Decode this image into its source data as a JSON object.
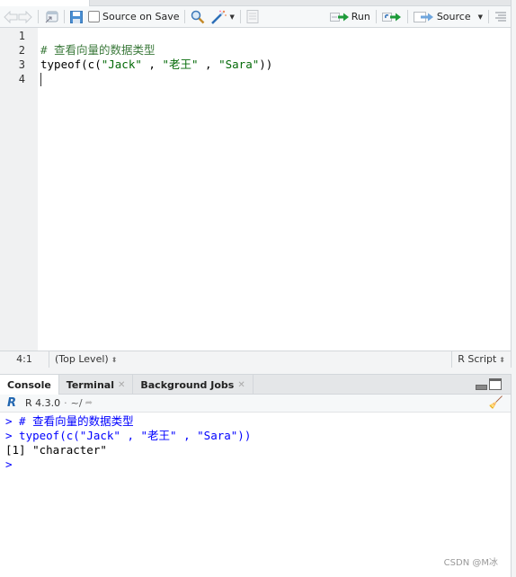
{
  "editor": {
    "toolbar": {
      "source_on_save_label": "Source on Save",
      "source_on_save_checked": false,
      "run_label": "Run",
      "source_label": "Source"
    },
    "line_numbers": [
      "1",
      "2",
      "3",
      "4"
    ],
    "lines": [
      {
        "parts": []
      },
      {
        "parts": [
          {
            "cls": "comment",
            "text": "# 查看向量的数据类型"
          }
        ]
      },
      {
        "parts": [
          {
            "cls": "",
            "text": "typeof(c("
          },
          {
            "cls": "str",
            "text": "\"Jack\""
          },
          {
            "cls": "",
            "text": " , "
          },
          {
            "cls": "str",
            "text": "\"老王\""
          },
          {
            "cls": "",
            "text": " , "
          },
          {
            "cls": "str",
            "text": "\"Sara\""
          },
          {
            "cls": "",
            "text": "))"
          }
        ]
      },
      {
        "parts": [],
        "cursor": true
      }
    ],
    "status": {
      "position": "4:1",
      "scope": "(Top Level)",
      "file_type": "R Script"
    }
  },
  "console": {
    "tabs": [
      {
        "label": "Console",
        "active": true,
        "closable": false
      },
      {
        "label": "Terminal",
        "active": false,
        "closable": true
      },
      {
        "label": "Background Jobs",
        "active": false,
        "closable": true
      }
    ],
    "r_version": "R 4.3.0",
    "separator": "·",
    "working_dir": "~/",
    "lines": [
      {
        "prompt": ">",
        "text": " # 查看向量的数据类型",
        "kind": "input"
      },
      {
        "prompt": ">",
        "text": " typeof(c(\"Jack\" , \"老王\" , \"Sara\"))",
        "kind": "input"
      },
      {
        "prompt": "",
        "text": "[1] \"character\"",
        "kind": "output"
      },
      {
        "prompt": ">",
        "text": "",
        "kind": "input"
      }
    ]
  },
  "watermark": "CSDN @M冰"
}
